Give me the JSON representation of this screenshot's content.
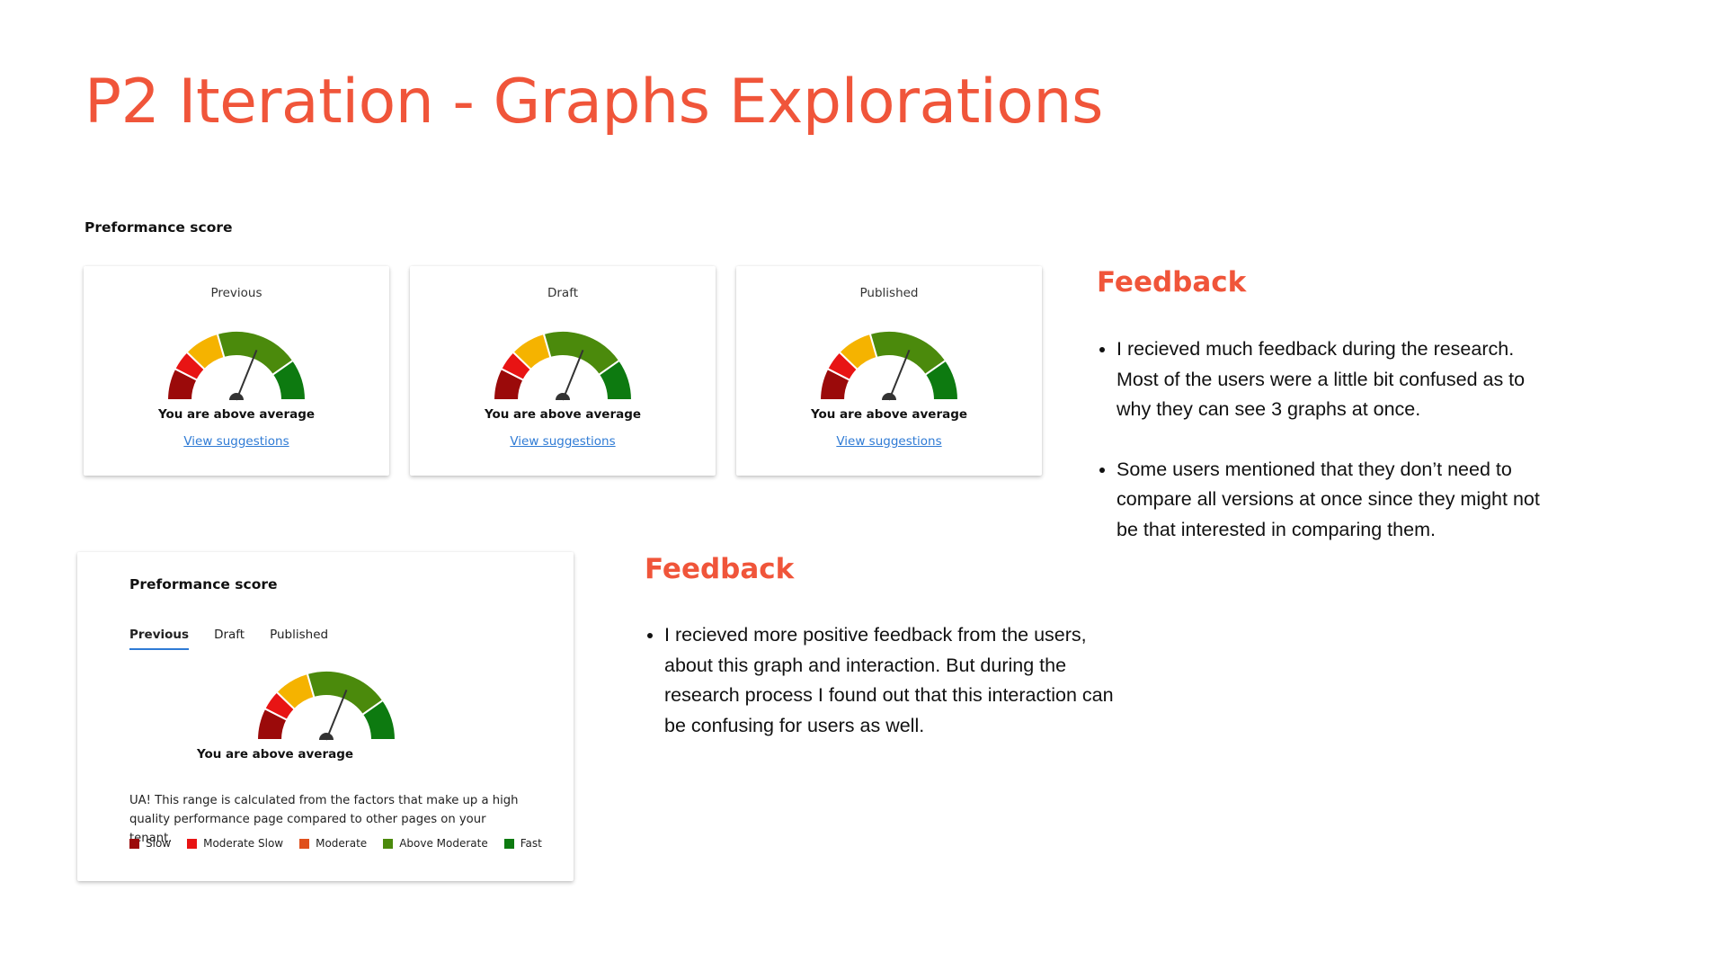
{
  "title": "P2 Iteration - Graphs Explorations",
  "top_section": {
    "label": "Preformance score",
    "cards": [
      {
        "label": "Previous",
        "status": "You are above average",
        "link": "View suggestions"
      },
      {
        "label": "Draft",
        "status": "You are above average",
        "link": "View suggestions"
      },
      {
        "label": "Published",
        "status": "You are above average",
        "link": "View suggestions"
      }
    ]
  },
  "bottom_card": {
    "title": "Preformance score",
    "tabs": [
      "Previous",
      "Draft",
      "Published"
    ],
    "active_tab": "Previous",
    "status": "You are above average",
    "note": "UA! This range is calculated from the factors that make up a high quality performance page compared to other pages on your tenant.",
    "legend": [
      {
        "label": "Slow",
        "color": "#9b0a0a"
      },
      {
        "label": "Moderate Slow",
        "color": "#e81414"
      },
      {
        "label": "Moderate",
        "color": "#e0501c"
      },
      {
        "label": "Above Moderate",
        "color": "#4b8a0c"
      },
      {
        "label": "Fast",
        "color": "#0d7a10"
      }
    ]
  },
  "gauge": {
    "segments": [
      {
        "name": "Slow",
        "color": "#9b0a0a"
      },
      {
        "name": "Moderate Slow",
        "color": "#e81414"
      },
      {
        "name": "Moderate",
        "color": "#f5b300"
      },
      {
        "name": "Above Moderate",
        "color": "#4b8a0c"
      },
      {
        "name": "Fast",
        "color": "#0d7a10"
      }
    ],
    "needle_color": "#333333"
  },
  "feedback_top": {
    "heading": "Feedback",
    "items": [
      "I recieved much feedback during the research. Most of the users were a little bit confused as to why they can see 3 graphs at once.",
      "Some users mentioned that they don’t need to compare all versions at once since they might not be that interested in comparing them."
    ]
  },
  "feedback_bottom": {
    "heading": "Feedback",
    "items": [
      "I recieved more positive feedback from the users, about this graph and interaction. But during the research process I found out that this interaction can be confusing for users as well."
    ]
  }
}
